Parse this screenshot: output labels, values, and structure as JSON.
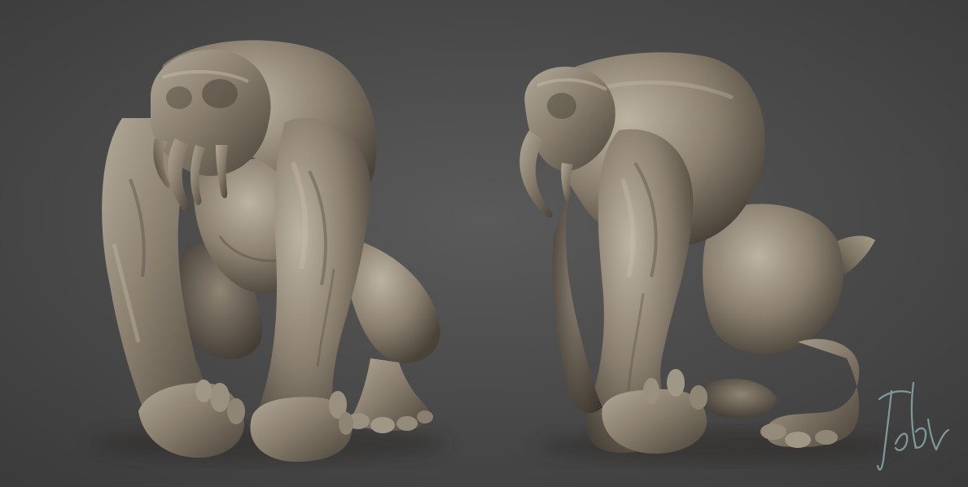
{
  "scene": {
    "background_colors": {
      "center": "#5a5a5a",
      "edge": "#3a3a3a"
    },
    "sculpt_material_colors": {
      "highlight": "#b3a998",
      "base": "#8a7f6f",
      "mid": "#706657",
      "shadow": "#3d3730",
      "deep_shadow": "#2a2521"
    }
  },
  "figures": [
    {
      "view": "front-three-quarter"
    },
    {
      "view": "side"
    }
  ],
  "signature": {
    "text": "JeSoh",
    "color": "#7f9a9a"
  }
}
